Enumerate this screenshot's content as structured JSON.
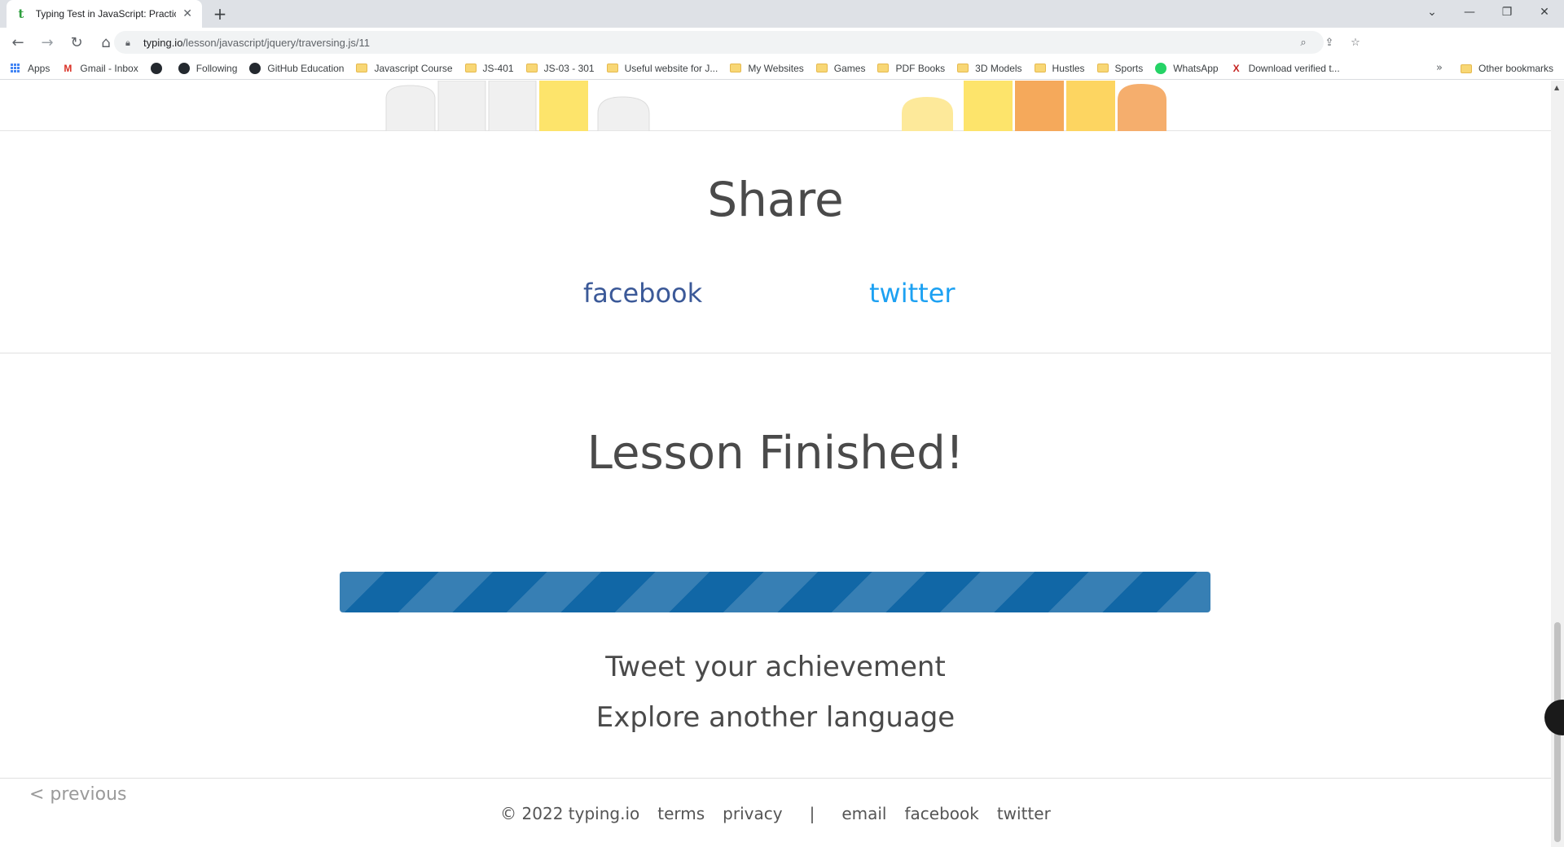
{
  "browser": {
    "tab_title": "Typing Test in JavaScript: Practice",
    "tab_favicon": "t",
    "url_host": "typing.io",
    "url_path": "/lesson/javascript/jquery/traversing.js/11",
    "bookmarks": [
      {
        "label": "Apps",
        "icon": "apps-grid-icon"
      },
      {
        "label": "Gmail - Inbox",
        "icon": "gmail-icon"
      },
      {
        "label": "",
        "icon": "github-icon"
      },
      {
        "label": "Following",
        "icon": "github-icon"
      },
      {
        "label": "GitHub Education",
        "icon": "github-icon"
      },
      {
        "label": "Javascript Course",
        "icon": "folder-icon"
      },
      {
        "label": "JS-401",
        "icon": "folder-icon"
      },
      {
        "label": "JS-03 - 301",
        "icon": "folder-icon"
      },
      {
        "label": "Useful website for J...",
        "icon": "folder-icon"
      },
      {
        "label": "My Websites",
        "icon": "folder-icon"
      },
      {
        "label": "Games",
        "icon": "folder-icon"
      },
      {
        "label": "PDF Books",
        "icon": "folder-icon"
      },
      {
        "label": "3D Models",
        "icon": "folder-icon"
      },
      {
        "label": "Hustles",
        "icon": "folder-icon"
      },
      {
        "label": "Sports",
        "icon": "folder-icon"
      },
      {
        "label": "WhatsApp",
        "icon": "whatsapp-icon"
      },
      {
        "label": "Download verified t...",
        "icon": "x-icon"
      }
    ],
    "other_bookmarks": "Other bookmarks"
  },
  "share": {
    "title": "Share",
    "facebook": "facebook",
    "twitter": "twitter"
  },
  "lesson": {
    "title": "Lesson Finished!",
    "progress_fraction": 1.0,
    "tweet": "Tweet your achievement",
    "explore": "Explore another language"
  },
  "footer": {
    "previous": "< previous",
    "copyright": "© 2022 typing.io",
    "terms": "terms",
    "privacy": "privacy",
    "separator": "|",
    "email": "email",
    "facebook": "facebook",
    "twitter": "twitter"
  },
  "colors": {
    "progress": "#1167a6",
    "facebook": "#3b5998",
    "twitter": "#1da1f2",
    "key_gray": "#f0f0f0",
    "key_yellow": "#fde46b",
    "key_orange": "#f5a95b"
  }
}
